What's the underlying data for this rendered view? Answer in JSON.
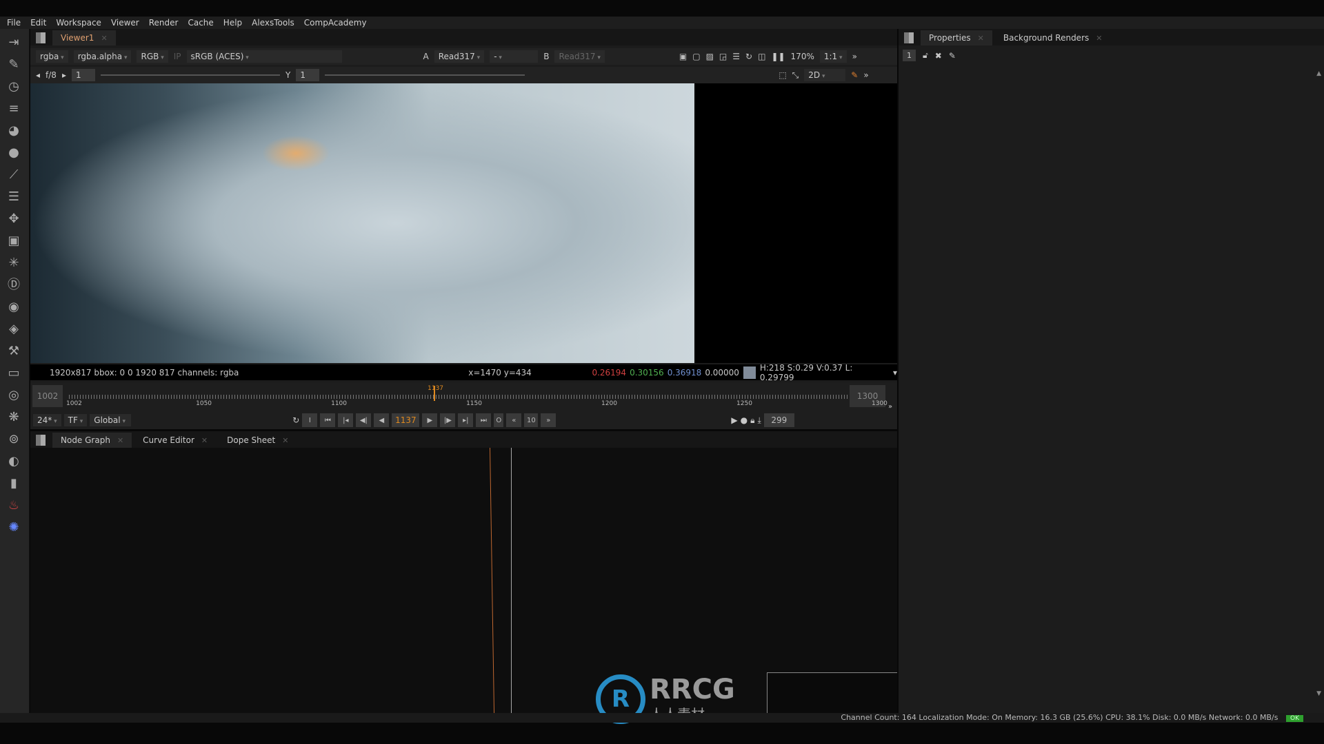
{
  "menu": [
    "File",
    "Edit",
    "Workspace",
    "Viewer",
    "Render",
    "Cache",
    "Help",
    "AlexsTools",
    "CompAcademy"
  ],
  "viewer": {
    "tab": "Viewer1",
    "channels": "rgba",
    "alpha": "rgba.alpha",
    "display": "RGB",
    "ip": "IP",
    "colorspace": "sRGB (ACES)",
    "a_label": "A",
    "a_input": "Read317",
    "wipe": "-",
    "b_label": "B",
    "b_input": "Read317",
    "zoom": "170%",
    "ratio": "1:1",
    "fstop": "f/8",
    "gain": "1",
    "gamma_label": "Y",
    "gamma": "1",
    "mode": "2D"
  },
  "info": {
    "format": "1920x817  bbox: 0 0 1920 817 channels: rgba",
    "coords": "x=1470 y=434",
    "r": "0.26194",
    "g": "0.30156",
    "b": "0.36918",
    "a": "0.00000",
    "hsv": "H:218 S:0.29 V:0.37  L: 0.29799",
    "colors": {
      "r": "#d04040",
      "g": "#50b050",
      "b": "#7090d0"
    }
  },
  "timeline": {
    "start": "1002",
    "end": "1300",
    "current": "1137",
    "ticks": [
      "1002",
      "1050",
      "1100",
      "1150",
      "1200",
      "1250",
      "1300"
    ],
    "fps": "24*",
    "tf": "TF",
    "range": "Global",
    "step": "10",
    "frames": "299",
    "current_fraction": 0.453
  },
  "nodegraph": {
    "tabs": [
      "Node Graph",
      "Curve Editor",
      "Dope Sheet"
    ]
  },
  "props": {
    "tabs": [
      "Properties",
      "Background Renders"
    ],
    "count": "1"
  },
  "status": {
    "text": "Channel Count: 164  Localization Mode: On  Memory: 16.3 GB (25.6%) CPU: 38.1% Disk: 0.0 MB/s Network: 0.0 MB/s",
    "ok": "OK"
  },
  "watermark": {
    "text": "RRCG",
    "sub": "人人素材"
  }
}
